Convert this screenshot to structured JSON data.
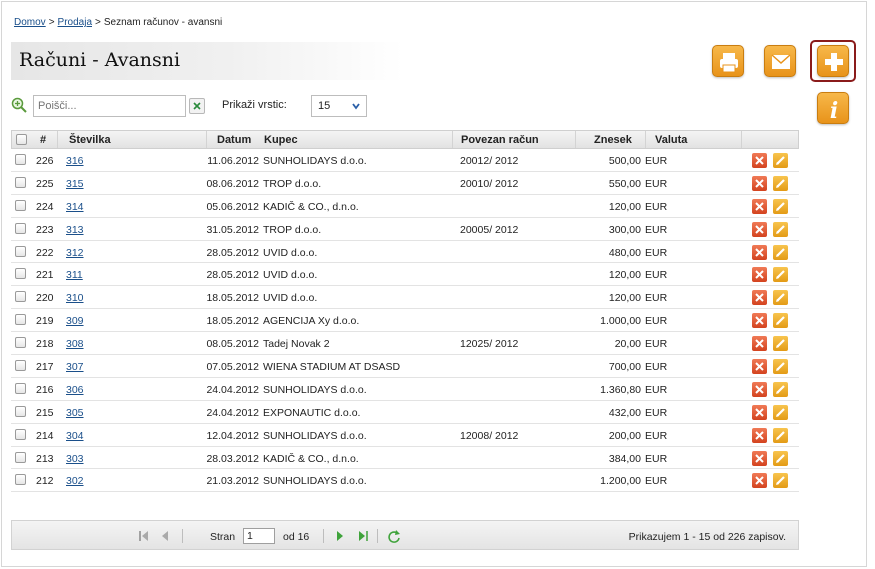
{
  "breadcrumb": {
    "home": "Domov",
    "separator": ">",
    "sales": "Prodaja",
    "current": "Seznam računov - avansni"
  },
  "page_title": "Računi - Avansni",
  "toolbar": {
    "print_icon": "printer-icon",
    "email_icon": "envelope-icon",
    "add_icon": "plus-icon",
    "info_icon": "info-icon",
    "accent_color": "#f0a030",
    "highlight_color": "#8a1b1b"
  },
  "search": {
    "placeholder": "Poišči...",
    "value": ""
  },
  "rows_per_page": {
    "label": "Prikaži vrstic:",
    "value": "15"
  },
  "table": {
    "columns": {
      "id": "#",
      "number": "Številka",
      "date": "Datum",
      "customer": "Kupec",
      "linked_invoice": "Povezan račun",
      "amount": "Znesek",
      "currency": "Valuta"
    },
    "rows": [
      {
        "id": "226",
        "number": "316",
        "date": "11.06.2012",
        "customer": "SUNHOLIDAYS d.o.o.",
        "linked": "20012/ 2012",
        "amount": "500,00",
        "currency": "EUR"
      },
      {
        "id": "225",
        "number": "315",
        "date": "08.06.2012",
        "customer": "TROP d.o.o.",
        "linked": "20010/ 2012",
        "amount": "550,00",
        "currency": "EUR"
      },
      {
        "id": "224",
        "number": "314",
        "date": "05.06.2012",
        "customer": "KADIČ & CO., d.n.o.",
        "linked": "",
        "amount": "120,00",
        "currency": "EUR"
      },
      {
        "id": "223",
        "number": "313",
        "date": "31.05.2012",
        "customer": "TROP d.o.o.",
        "linked": "20005/ 2012",
        "amount": "300,00",
        "currency": "EUR"
      },
      {
        "id": "222",
        "number": "312",
        "date": "28.05.2012",
        "customer": "UVID d.o.o.",
        "linked": "",
        "amount": "480,00",
        "currency": "EUR"
      },
      {
        "id": "221",
        "number": "311",
        "date": "28.05.2012",
        "customer": "UVID d.o.o.",
        "linked": "",
        "amount": "120,00",
        "currency": "EUR"
      },
      {
        "id": "220",
        "number": "310",
        "date": "18.05.2012",
        "customer": "UVID d.o.o.",
        "linked": "",
        "amount": "120,00",
        "currency": "EUR"
      },
      {
        "id": "219",
        "number": "309",
        "date": "18.05.2012",
        "customer": "AGENCIJA Xy d.o.o.",
        "linked": "",
        "amount": "1.000,00",
        "currency": "EUR"
      },
      {
        "id": "218",
        "number": "308",
        "date": "08.05.2012",
        "customer": "Tadej Novak 2",
        "linked": "12025/ 2012",
        "amount": "20,00",
        "currency": "EUR"
      },
      {
        "id": "217",
        "number": "307",
        "date": "07.05.2012",
        "customer": "WIENA STADIUM AT DSASD",
        "linked": "",
        "amount": "700,00",
        "currency": "EUR"
      },
      {
        "id": "216",
        "number": "306",
        "date": "24.04.2012",
        "customer": "SUNHOLIDAYS d.o.o.",
        "linked": "",
        "amount": "1.360,80",
        "currency": "EUR"
      },
      {
        "id": "215",
        "number": "305",
        "date": "24.04.2012",
        "customer": "EXPONAUTIC d.o.o.",
        "linked": "",
        "amount": "432,00",
        "currency": "EUR"
      },
      {
        "id": "214",
        "number": "304",
        "date": "12.04.2012",
        "customer": "SUNHOLIDAYS d.o.o.",
        "linked": "12008/ 2012",
        "amount": "200,00",
        "currency": "EUR"
      },
      {
        "id": "213",
        "number": "303",
        "date": "28.03.2012",
        "customer": "KADIČ & CO., d.n.o.",
        "linked": "",
        "amount": "384,00",
        "currency": "EUR"
      },
      {
        "id": "212",
        "number": "302",
        "date": "21.03.2012",
        "customer": "SUNHOLIDAYS d.o.o.",
        "linked": "",
        "amount": "1.200,00",
        "currency": "EUR"
      }
    ]
  },
  "pager": {
    "page_label": "Stran",
    "page_value": "1",
    "of_label": "od 16",
    "status": "Prikazujem 1 - 15 od 226 zapisov."
  }
}
